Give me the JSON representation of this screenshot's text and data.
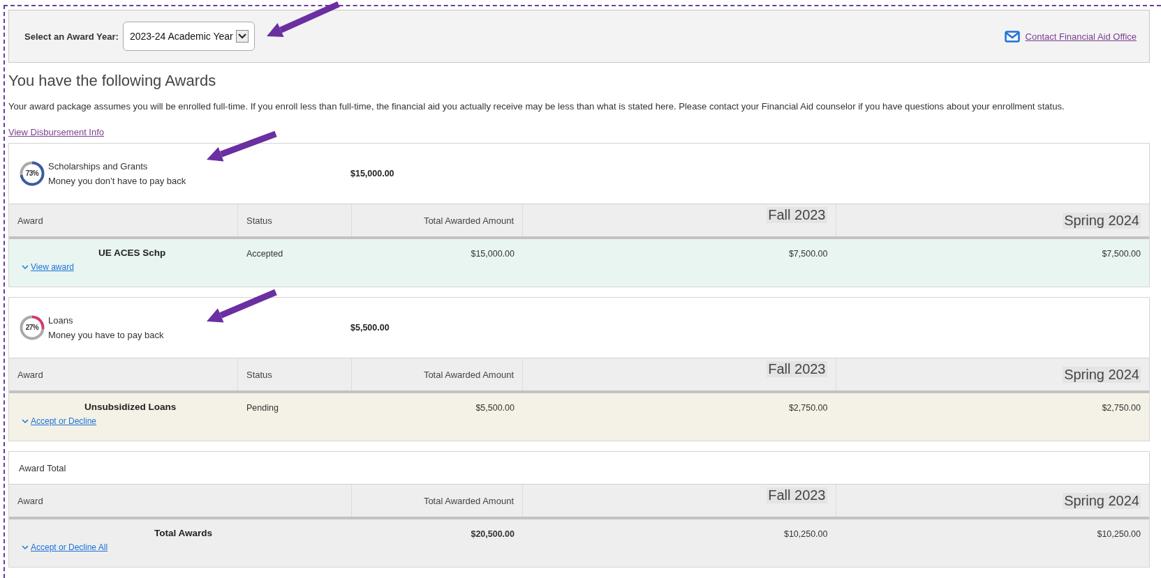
{
  "top_bar": {
    "label": "Select an Award Year:",
    "year_select": {
      "value": "2023-24 Academic Year"
    },
    "contact_link": "Contact Financial Aid Office"
  },
  "heading": "You have the following Awards",
  "notice": "Your award package assumes you will be enrolled full-time. If you enroll less than full-time, the financial aid you actually receive may be less than what is stated here. Please contact your Financial Aid counselor if you have questions about your enrollment status.",
  "disbursement_link": "View Disbursement Info",
  "sections": [
    {
      "kind": "category",
      "title": "Scholarships and Grants",
      "subtitle": "Money you don’t have to pay back",
      "percent": "73%",
      "chart_data": {
        "type": "donut",
        "values": [
          73,
          27
        ]
      },
      "color": "#3b5ca0",
      "amount": "$15,000.00",
      "columns": [
        "Award",
        "Status",
        "Total Awarded Amount",
        "Fall 2023",
        "Spring 2024"
      ],
      "rows": [
        {
          "kind": "accepted",
          "award": "UE ACES Schp",
          "status": "Accepted",
          "total": "$15,000.00",
          "terms": [
            "$7,500.00",
            "$7,500.00"
          ],
          "action": "View award"
        }
      ]
    },
    {
      "kind": "category",
      "title": "Loans",
      "subtitle": "Money you have to pay back",
      "percent": "27%",
      "chart_data": {
        "type": "donut",
        "values": [
          27,
          73
        ]
      },
      "color": "#d13a6c",
      "amount": "$5,500.00",
      "columns": [
        "Award",
        "Status",
        "Total Awarded Amount",
        "Fall 2023",
        "Spring 2024"
      ],
      "rows": [
        {
          "kind": "pending",
          "award": "Unsubsidized Loans",
          "status": "Pending",
          "total": "$5,500.00",
          "terms": [
            "$2,750.00",
            "$2,750.00"
          ],
          "action": "Accept or Decline"
        }
      ]
    },
    {
      "kind": "total",
      "title": "Award Total",
      "columns": [
        "Award",
        "Total Awarded Amount",
        "Fall 2023",
        "Spring 2024"
      ],
      "rows": [
        {
          "kind": "total",
          "award": "Total Awards",
          "total": "$20,500.00",
          "terms": [
            "$10,250.00",
            "$10,250.00"
          ],
          "action": "Accept or Decline All"
        }
      ]
    }
  ]
}
